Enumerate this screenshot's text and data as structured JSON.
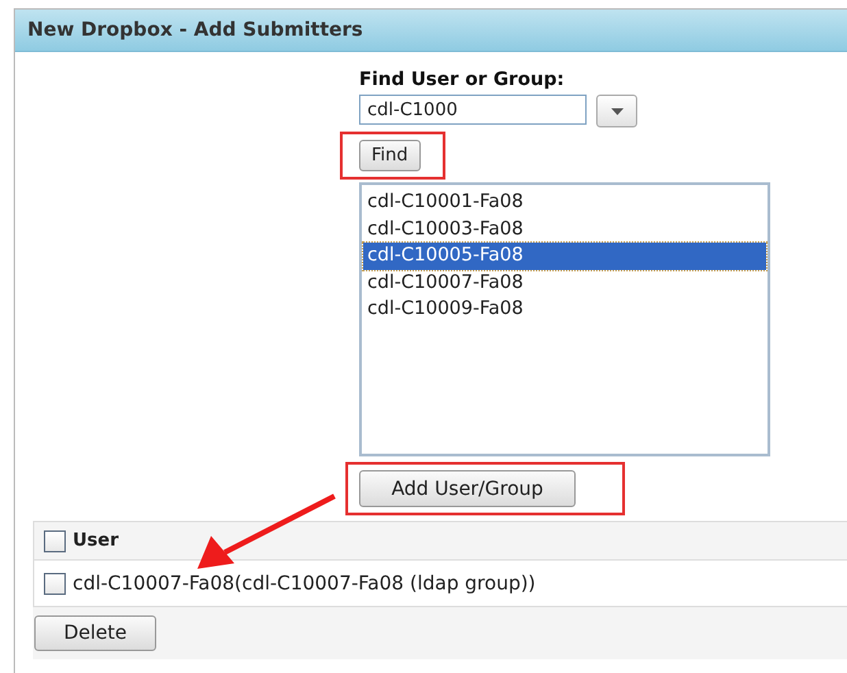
{
  "window": {
    "title": "New Dropbox - Add Submitters"
  },
  "find": {
    "label": "Find User or Group:",
    "value": "cdl-C1000",
    "button": "Find"
  },
  "results": [
    {
      "label": "cdl-C10001-Fa08",
      "selected": false
    },
    {
      "label": "cdl-C10003-Fa08",
      "selected": false
    },
    {
      "label": "cdl-C10005-Fa08",
      "selected": true
    },
    {
      "label": "cdl-C10007-Fa08",
      "selected": false
    },
    {
      "label": "cdl-C10009-Fa08",
      "selected": false
    }
  ],
  "add_button": "Add User/Group",
  "table": {
    "header": {
      "label": "User",
      "checked": false
    },
    "rows": [
      {
        "label": "cdl-C10007-Fa08(cdl-C10007-Fa08 (ldap group))",
        "checked": false
      }
    ]
  },
  "delete_button": "Delete"
}
